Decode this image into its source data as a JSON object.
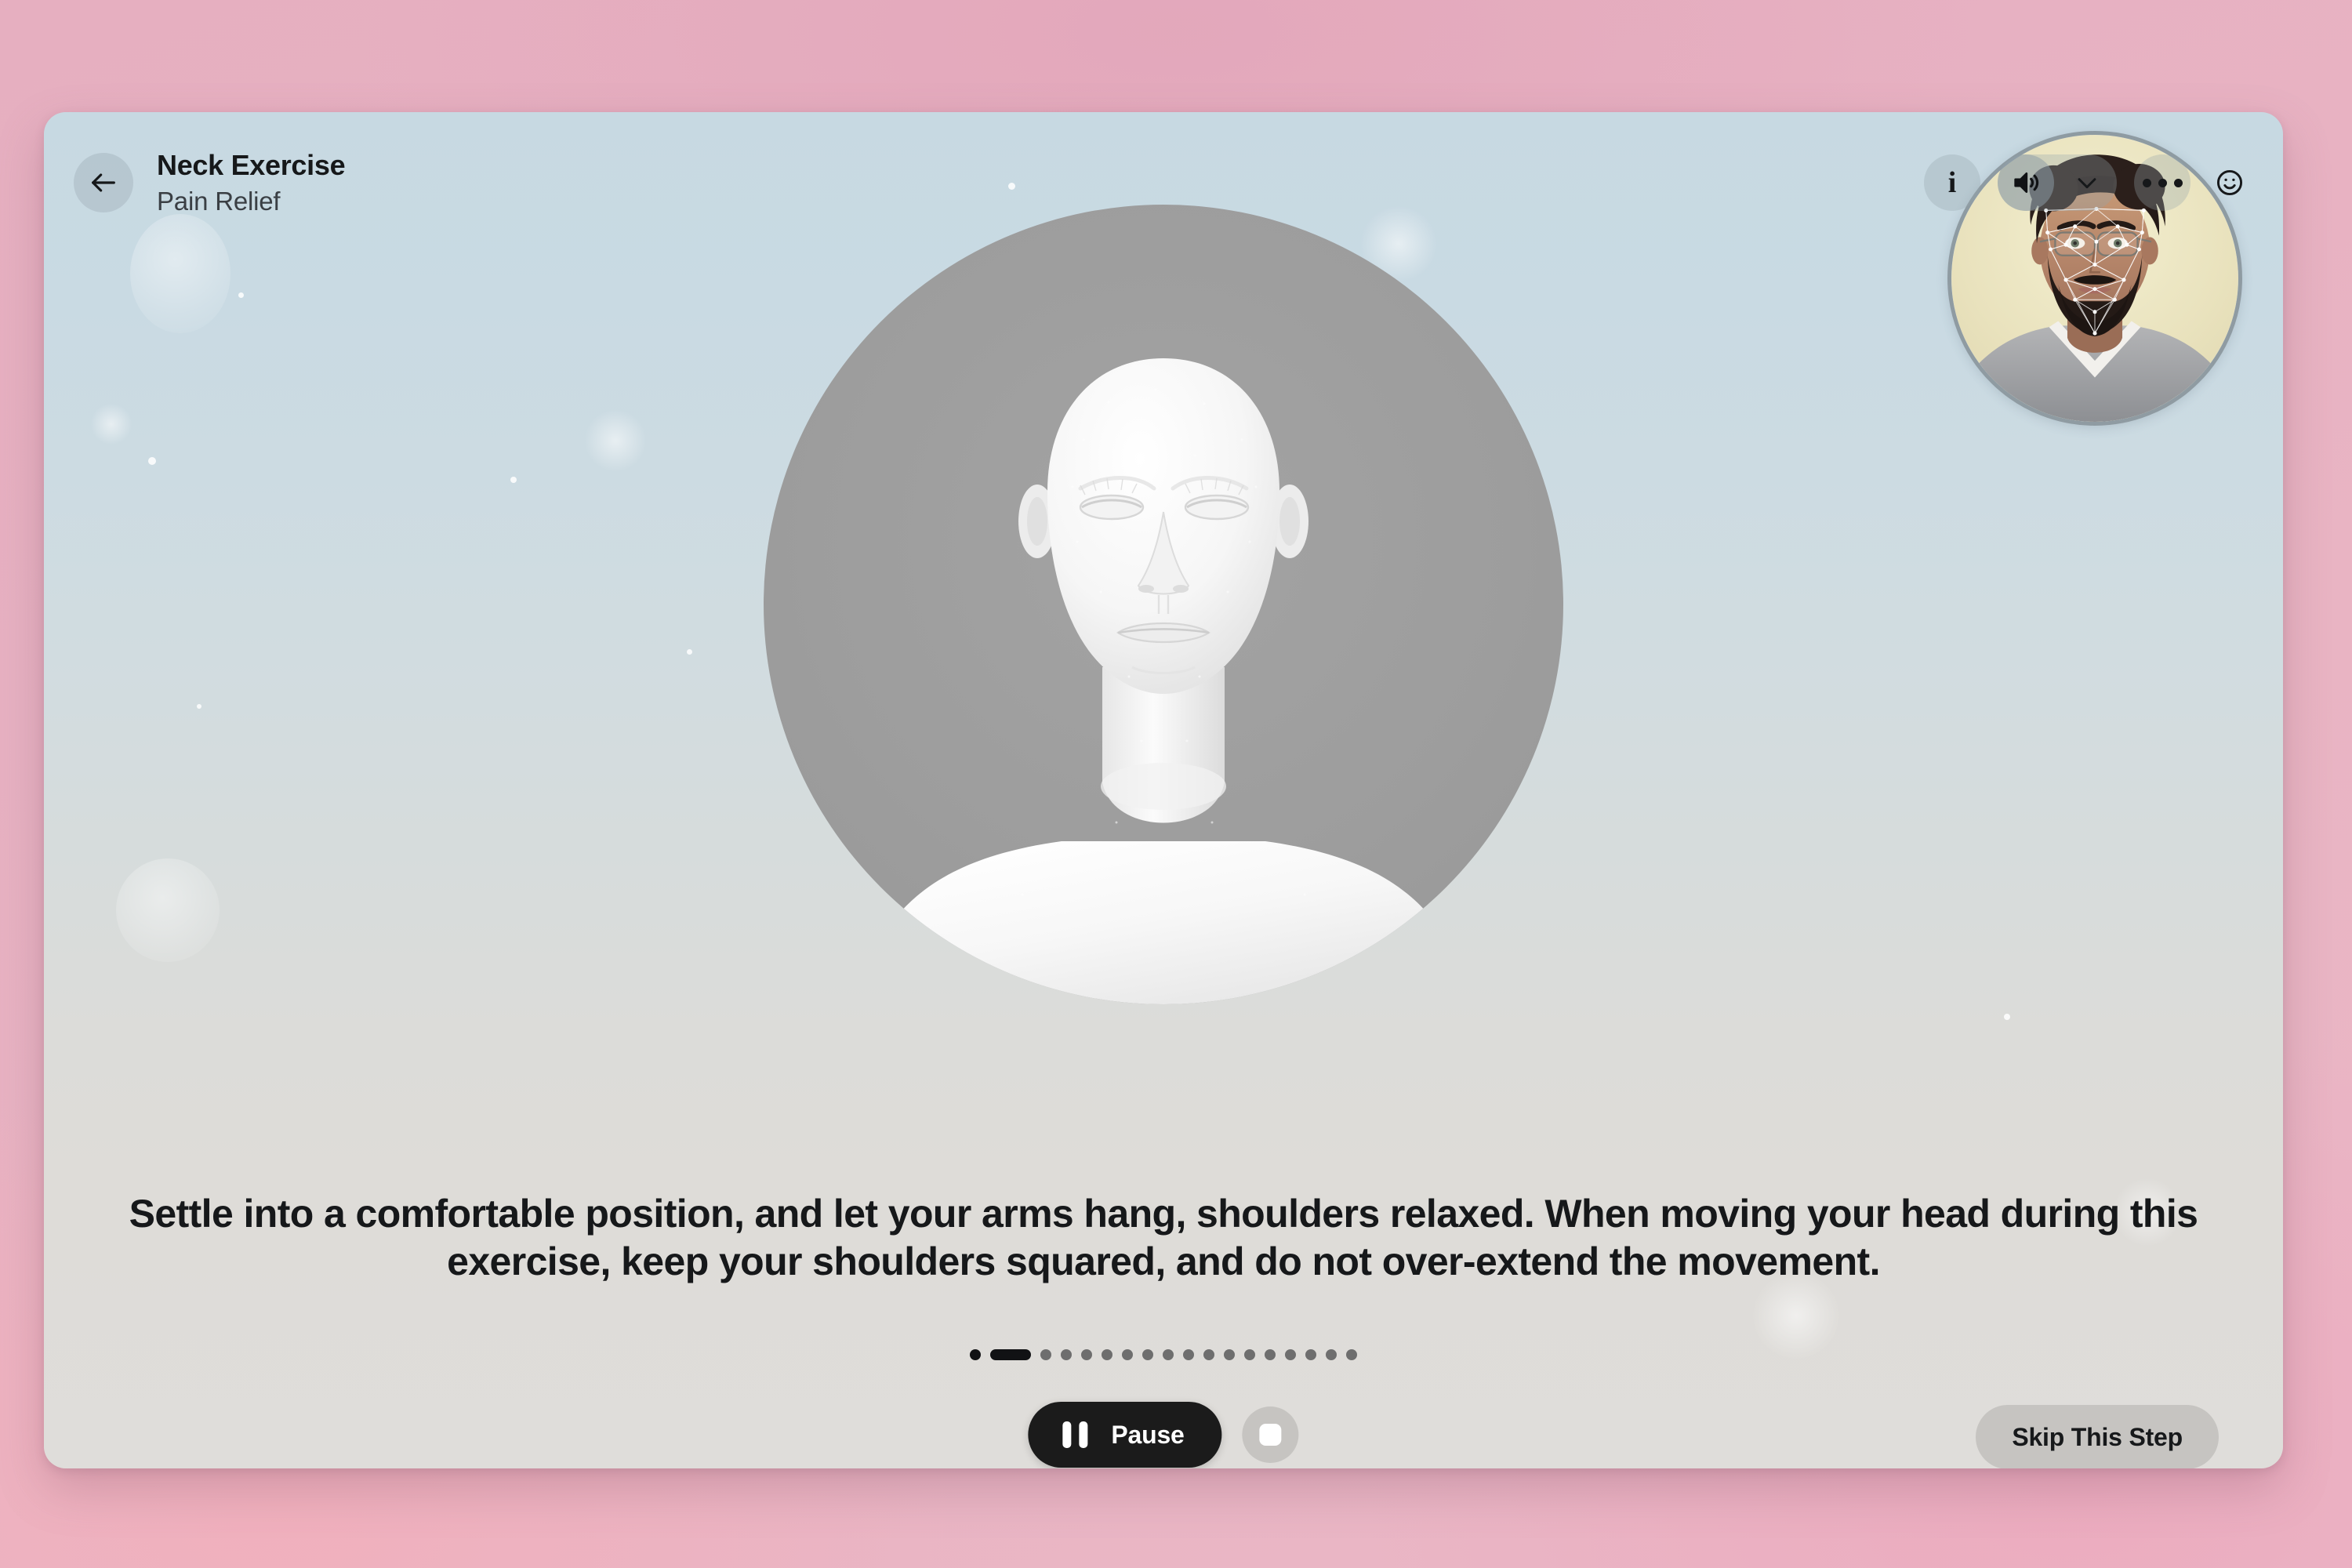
{
  "header": {
    "back_icon": "arrow-left-icon",
    "title": "Neck Exercise",
    "subtitle": "Pain Relief",
    "actions": {
      "info_glyph": "i",
      "info_icon": "info-icon",
      "speaker_icon": "speaker-volume-icon",
      "chevron_icon": "chevron-down-icon",
      "more_icon": "more-horizontal-icon",
      "smiley_icon": "smiley-face-icon"
    }
  },
  "webcam": {
    "label": "user-camera-feed",
    "overlay": "face-tracking-mesh"
  },
  "avatar": {
    "label": "3d-head-avatar",
    "disc_color": "#9d9d9d"
  },
  "instruction": {
    "text": "Settle into a comfortable position, and let your arms hang, shoulders relaxed. When moving your head during this exercise, keep your shoulders squared, and do not over-extend the movement."
  },
  "progress": {
    "total_steps": 18,
    "current_step": 2,
    "steps": [
      "done",
      "active",
      "todo",
      "todo",
      "todo",
      "todo",
      "todo",
      "todo",
      "todo",
      "todo",
      "todo",
      "todo",
      "todo",
      "todo",
      "todo",
      "todo",
      "todo",
      "todo"
    ]
  },
  "controls": {
    "pause_label": "Pause",
    "pause_icon": "pause-icon",
    "stop_icon": "stop-square-icon",
    "skip_label": "Skip This Step"
  },
  "colors": {
    "page_background": "#e8b3c3",
    "card_top": "#c7d9e2",
    "card_bottom": "#dfdddA",
    "accent_dark": "#1b1b1b",
    "text_primary": "#16181a",
    "text_secondary": "#3a3f44",
    "dot_inactive": "#6e6e6e"
  }
}
